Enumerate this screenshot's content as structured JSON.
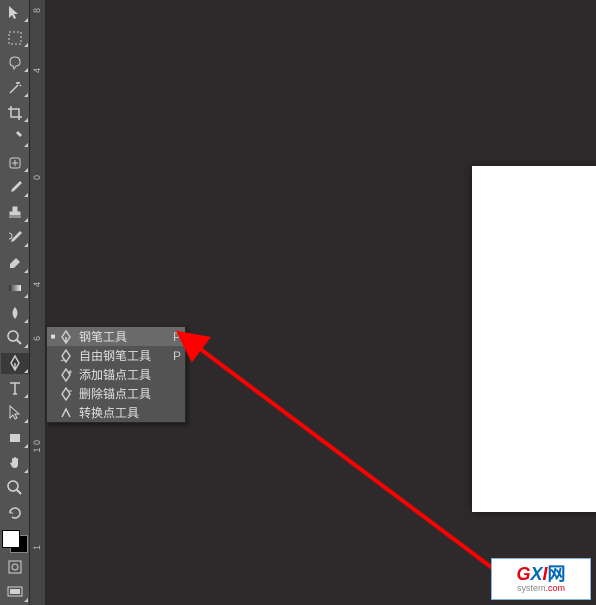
{
  "ruler": {
    "ticks": [
      "8",
      "4",
      "0",
      "4",
      "6",
      "1 0",
      "1"
    ]
  },
  "flyout": {
    "items": [
      {
        "label": "钢笔工具",
        "shortcut": "P",
        "active": true,
        "icon": "nib"
      },
      {
        "label": "自由钢笔工具",
        "shortcut": "P",
        "active": false,
        "icon": "nib"
      },
      {
        "label": "添加锚点工具",
        "shortcut": "",
        "active": false,
        "icon": "nib-plus"
      },
      {
        "label": "删除锚点工具",
        "shortcut": "",
        "active": false,
        "icon": "nib-minus"
      },
      {
        "label": "转换点工具",
        "shortcut": "",
        "active": false,
        "icon": "angle"
      }
    ]
  },
  "tools": [
    {
      "name": "move-tool"
    },
    {
      "name": "marquee-tool"
    },
    {
      "name": "lasso-tool"
    },
    {
      "name": "magic-wand-tool"
    },
    {
      "name": "crop-tool"
    },
    {
      "name": "eyedropper-tool"
    },
    {
      "name": "healing-brush-tool"
    },
    {
      "name": "brush-tool"
    },
    {
      "name": "stamp-tool"
    },
    {
      "name": "history-brush-tool"
    },
    {
      "name": "eraser-tool"
    },
    {
      "name": "gradient-tool"
    },
    {
      "name": "blur-tool"
    },
    {
      "name": "dodge-tool"
    },
    {
      "name": "pen-tool"
    },
    {
      "name": "type-tool"
    },
    {
      "name": "path-selection-tool"
    },
    {
      "name": "rectangle-tool"
    },
    {
      "name": "hand-tool"
    },
    {
      "name": "zoom-tool"
    },
    {
      "name": "rotate-view-tool"
    }
  ],
  "logo": {
    "main_g": "G",
    "main_x": "X",
    "main_i": "I",
    "main_wang": "网",
    "sub_prefix": "system",
    "sub_suffix": ".com"
  }
}
